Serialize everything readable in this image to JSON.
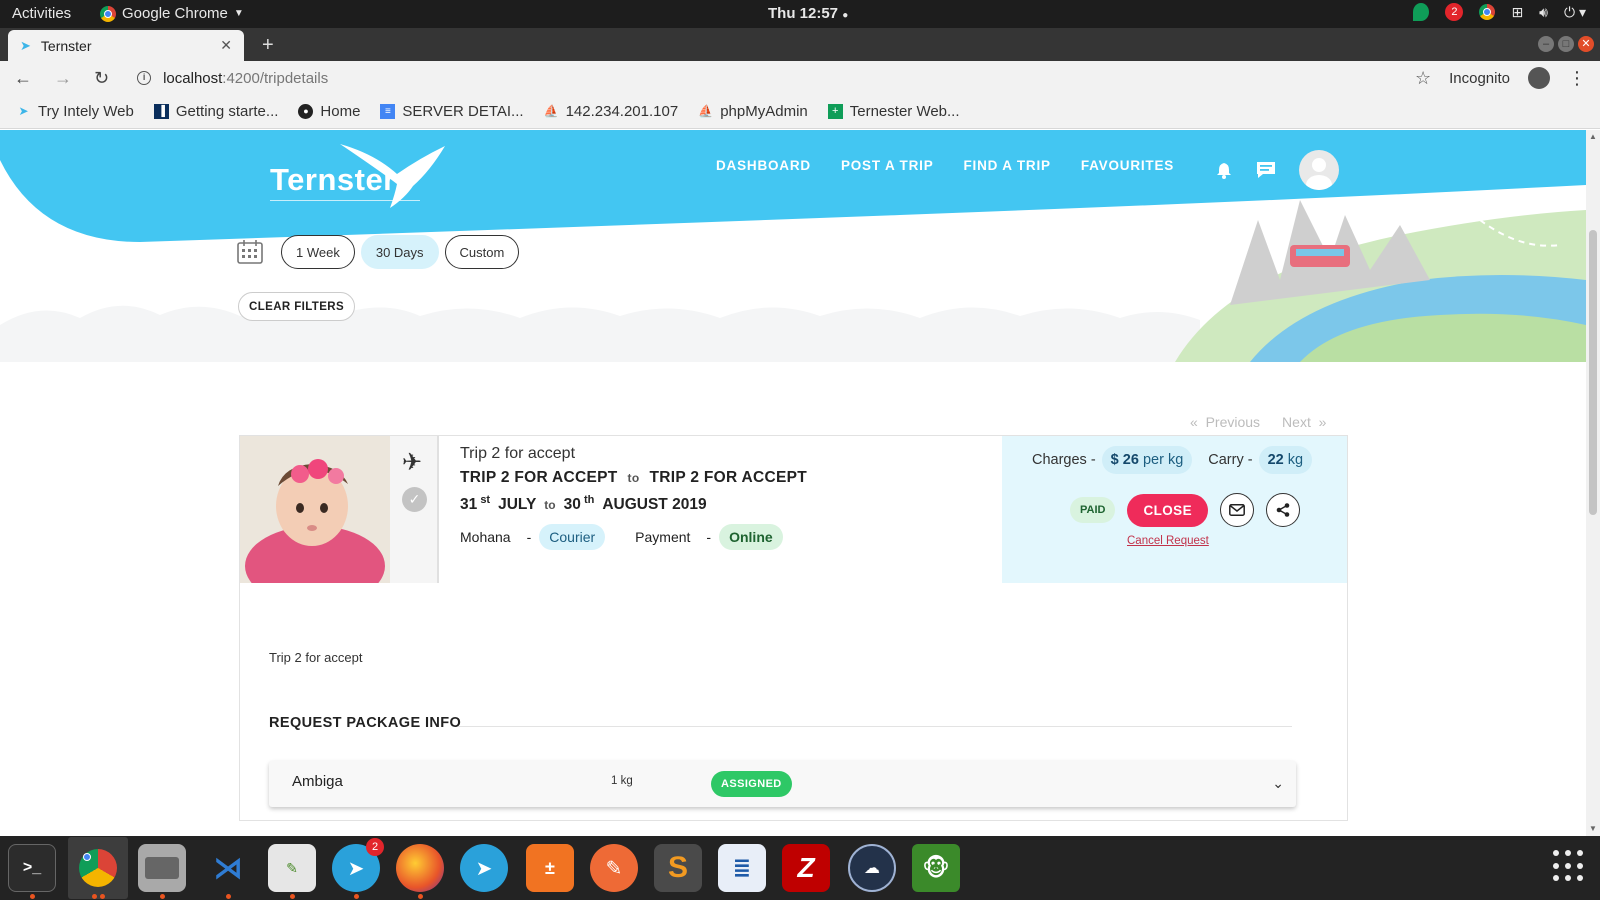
{
  "system_bar": {
    "activities": "Activities",
    "app_name": "Google Chrome",
    "clock": "Thu 12:57",
    "notification_count": "2"
  },
  "browser": {
    "tab_title": "Ternster",
    "url_host": "localhost",
    "url_path": ":4200/tripdetails",
    "profile_label": "Incognito",
    "bookmarks": [
      {
        "label": "Try Intely Web",
        "icon": "bird-icon"
      },
      {
        "label": "Getting starte...",
        "icon": "trello-icon"
      },
      {
        "label": "Home",
        "icon": "github-icon"
      },
      {
        "label": "SERVER DETAI...",
        "icon": "doc-icon"
      },
      {
        "label": "142.234.201.107",
        "icon": "phpmyadmin-icon"
      },
      {
        "label": "phpMyAdmin",
        "icon": "phpmyadmin-icon"
      },
      {
        "label": "Ternester Web...",
        "icon": "sheets-icon"
      }
    ]
  },
  "site": {
    "logo_text": "Ternster",
    "nav": [
      "DASHBOARD",
      "POST A TRIP",
      "FIND A TRIP",
      "FAVOURITES"
    ],
    "brand_color": "#43c6f2"
  },
  "filters": {
    "options": [
      "1 Week",
      "30 Days",
      "Custom"
    ],
    "active": "30 Days",
    "clear_label": "CLEAR FILTERS"
  },
  "pagination": {
    "previous": "Previous",
    "next": "Next"
  },
  "trip": {
    "title": "Trip 2 for accept",
    "from": "TRIP 2 FOR ACCEPT",
    "to_word": "to",
    "to": "TRIP 2 FOR ACCEPT",
    "start_day": "31",
    "start_suffix": "st",
    "start_month": "JULY",
    "end_day": "30",
    "end_suffix": "th",
    "end_month": "AUGUST 2019",
    "traveler_name": "Mohana",
    "traveler_type": "Courier",
    "payment_label": "Payment",
    "payment_method": "Online",
    "charges_label": "Charges -",
    "charges_currency": "$",
    "charges_amount": "26",
    "charges_unit": "per kg",
    "carry_label": "Carry -",
    "carry_amount": "22",
    "carry_unit": "kg",
    "paid_label": "PAID",
    "close_label": "CLOSE",
    "cancel_label": "Cancel Request",
    "description": "Trip 2 for accept",
    "section_title": "REQUEST PACKAGE INFO",
    "packages": [
      {
        "name": "Ambiga",
        "weight": "1 kg",
        "status": "ASSIGNED"
      }
    ]
  },
  "dock": {
    "telegram_badge": "2"
  }
}
